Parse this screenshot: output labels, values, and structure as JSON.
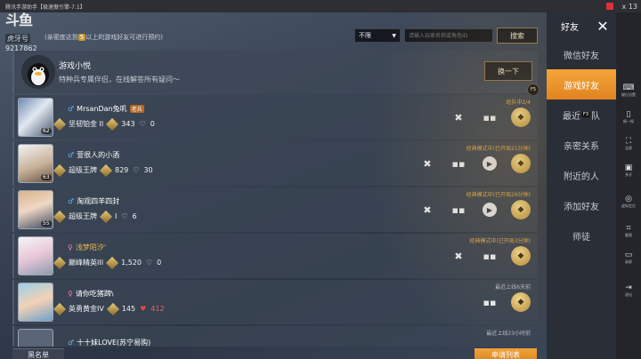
{
  "window": {
    "title": "腾讯手游助手【极速傲引擎-7.1】",
    "count": "x 13"
  },
  "logo": {
    "main": "斗鱼",
    "tag": "虎牙号",
    "id": "9217862"
  },
  "top_hint": {
    "pre": "(亲密度达到",
    "badge": "5",
    "post": "以上的游戏好友可进行预约)"
  },
  "search": {
    "filter": "不限",
    "placeholder": "请输入玩家名称或角色ID",
    "button": "搜索"
  },
  "assistant": {
    "title": "游戏小悦",
    "desc": "特种兵专属伴侣，在线解答所有疑问～",
    "button": "换一下",
    "hotkey": "F5"
  },
  "friends": [
    {
      "name": "MrsanDan兔叽",
      "tag": "老兵",
      "rank": "坚韧铂金 II",
      "score": "343",
      "likes": "0",
      "status": "组队中2/4",
      "level": "62"
    },
    {
      "name": "萱很人的小酒",
      "rank": "超级王牌",
      "score": "829",
      "likes": "30",
      "status": "经典模式中(已开局21分钟)",
      "level": "63"
    },
    {
      "name": "淘观四羊四封",
      "rank": "超级王牌",
      "score": "I",
      "likes": "6",
      "status": "经典模式中(已开局26分钟)",
      "level": "55"
    },
    {
      "name": "浅梦陌汐'",
      "rank": "巅峰精英III",
      "score": "1,520",
      "likes": "0",
      "status": "经典模式中(已开局3分钟)",
      "level": ""
    },
    {
      "name": "请你吃猪蹄\\",
      "rank": "英勇黄金IV",
      "score": "145",
      "likes": "412",
      "status": "最近上线6天前",
      "level": ""
    },
    {
      "name": "十十妹LOVE(苏宁易购)",
      "status": "最近上线23小时前"
    }
  ],
  "bottom": {
    "left": "黑名单",
    "right": "申请列表"
  },
  "panel": {
    "title": "好友",
    "tabs": [
      "微信好友",
      "游戏好友",
      "最近",
      "队",
      "亲密关系",
      "附近的人",
      "添加好友",
      "师徒"
    ],
    "tab_hotkey": "F3"
  },
  "emulator": [
    "键位设置",
    "摇一摇",
    "全屏",
    "多开",
    "虚拟定位",
    "截图",
    "录屏",
    "退出"
  ]
}
